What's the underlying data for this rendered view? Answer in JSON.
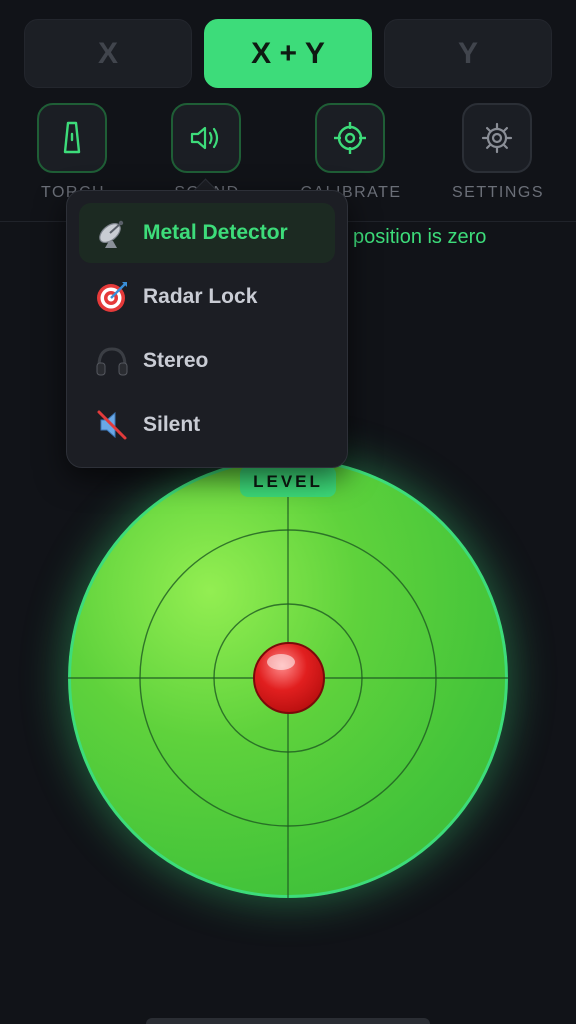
{
  "axis_tabs": [
    {
      "label": "X",
      "active": false
    },
    {
      "label": "X + Y",
      "active": true
    },
    {
      "label": "Y",
      "active": false
    }
  ],
  "tools": [
    {
      "label": "TORCH",
      "icon": "torch-icon"
    },
    {
      "label": "SOUND",
      "icon": "speaker-icon"
    },
    {
      "label": "CALIBRATE",
      "icon": "crosshair-icon"
    },
    {
      "label": "SETTINGS",
      "icon": "gear-icon"
    }
  ],
  "status": {
    "text": "position is zero"
  },
  "sound_menu": {
    "selected_index": 0,
    "items": [
      {
        "label": "Metal Detector",
        "icon": "satellite-dish-icon"
      },
      {
        "label": "Radar Lock",
        "icon": "target-icon"
      },
      {
        "label": "Stereo",
        "icon": "headphones-icon"
      },
      {
        "label": "Silent",
        "icon": "muted-speaker-icon"
      }
    ]
  },
  "level": {
    "badge": "LEVEL",
    "bubble_x": 0,
    "bubble_y": 0
  },
  "colors": {
    "accent": "#3ddc7a",
    "background": "#111318",
    "level_green": "#5fd23c",
    "bubble_red": "#e11f1f"
  }
}
